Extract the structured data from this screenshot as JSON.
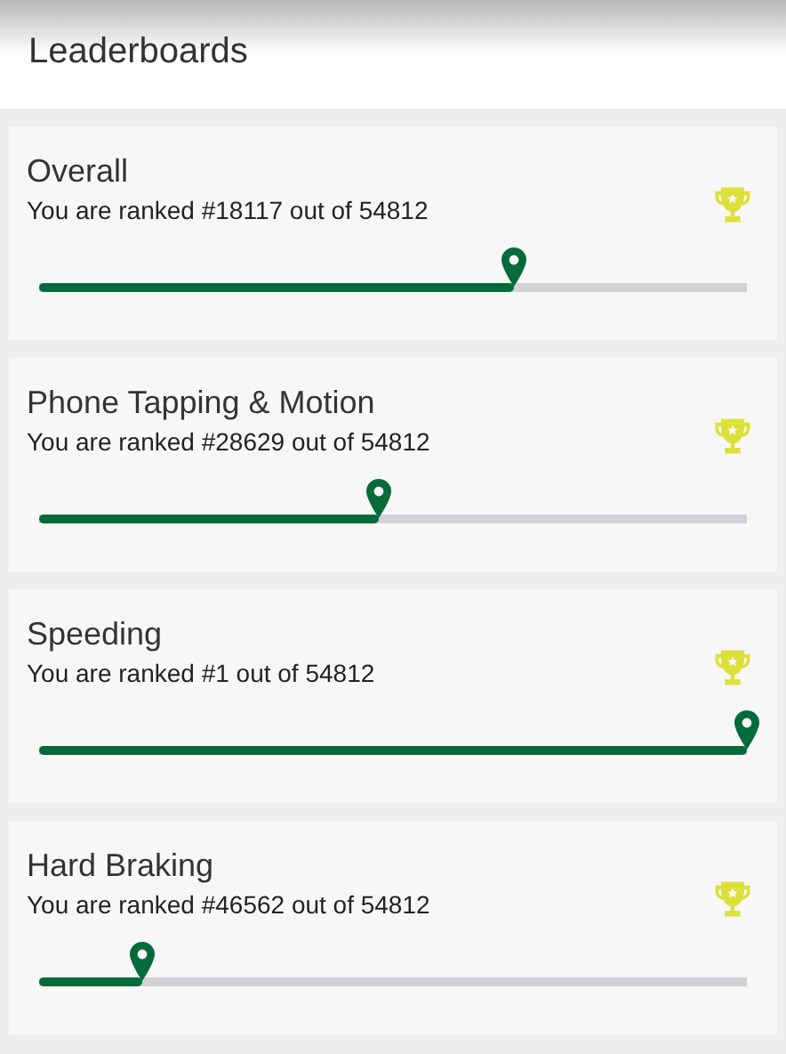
{
  "header": {
    "title": "Leaderboards"
  },
  "boards": [
    {
      "title": "Overall",
      "rank_text": "You are ranked #18117 out of 54812",
      "level": 0.67
    },
    {
      "title": "Phone Tapping & Motion",
      "rank_text": "You are ranked #28629 out of 54812",
      "level": 0.48
    },
    {
      "title": "Speeding",
      "rank_text": "You are ranked #1 out of 54812",
      "level": 1
    },
    {
      "title": "Hard Braking",
      "rank_text": "You are ranked #46562 out of 54812",
      "level": 0.145
    }
  ]
}
